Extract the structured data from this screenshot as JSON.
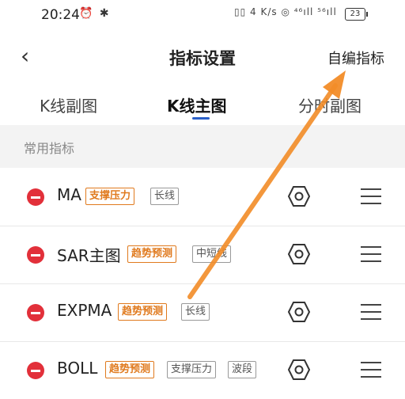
{
  "status_bar": {
    "time": "20:24",
    "left_icons": "⏰ ✱",
    "right_icons": "▯▯ 4 K/s ◎ ⁴⁶ıll ⁵⁶ıll",
    "battery": "23"
  },
  "header": {
    "back_icon": "‹",
    "title": "指标设置",
    "custom_label": "自编指标"
  },
  "tabs": [
    {
      "label": "K线副图"
    },
    {
      "label": "K线主图",
      "active": true
    },
    {
      "label": "分时副图"
    }
  ],
  "section_title": "常用指标",
  "indicators": [
    {
      "name": "MA",
      "tags": [
        "支撑压力",
        "长线"
      ]
    },
    {
      "name": "SAR主图",
      "tags": [
        "趋势预测",
        "中短线"
      ]
    },
    {
      "name": "EXPMA",
      "tags": [
        "趋势预测",
        "长线"
      ]
    },
    {
      "name": "BOLL",
      "tags": [
        "趋势预测",
        "支撑压力",
        "波段"
      ]
    }
  ],
  "colors": {
    "accent_blue": "#2a5fc8",
    "remove_red": "#e2303a",
    "tag_orange": "#e07a1e",
    "annotation_arrow": "#f28c28"
  },
  "icons": [
    "alarm-icon",
    "bluetooth-icon",
    "vibrate-icon",
    "wifi-icon",
    "signal-icon",
    "battery-icon",
    "back-icon",
    "remove-icon",
    "settings-hex-icon",
    "drag-handle-icon"
  ]
}
